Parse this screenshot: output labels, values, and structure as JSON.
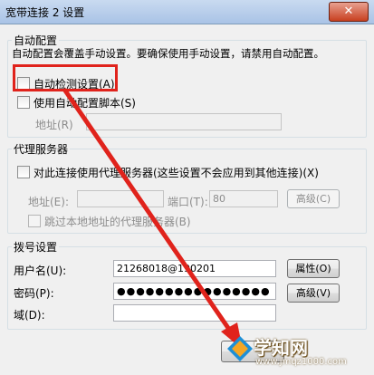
{
  "window": {
    "title": "宽带连接 2 设置",
    "close_label": "✕"
  },
  "auto_config": {
    "group_title": "自动配置",
    "description": "自动配置会覆盖手动设置。要确保使用手动设置，请禁用自动配置。",
    "auto_detect_label": "自动检测设置(A)",
    "auto_detect_checked": false,
    "use_script_label": "使用自动配置脚本(S)",
    "use_script_checked": false,
    "address_label": "地址(R)",
    "address_value": ""
  },
  "proxy": {
    "group_title": "代理服务器",
    "use_proxy_label": "对此连接使用代理服务器(这些设置不会应用到其他连接)(X)",
    "use_proxy_checked": false,
    "address_label": "地址(E):",
    "address_value": "",
    "port_label": "端口(T):",
    "port_value": "80",
    "advanced_label": "高级(C)",
    "bypass_label": "跳过本地地址的代理服务器(B)",
    "bypass_checked": false
  },
  "dialup": {
    "group_title": "拨号设置",
    "username_label": "用户名(U):",
    "username_value": "21268018@190201",
    "password_label": "密码(P):",
    "password_value": "●●●●●●●●●●●●●●●●",
    "domain_label": "域(D):",
    "domain_value": "",
    "properties_label": "属性(O)",
    "advanced_label": "高级(V)"
  },
  "watermark": {
    "text": "学知网",
    "url": "www.jmqz1000.com"
  },
  "colors": {
    "highlight": "#e0231c",
    "arrow": "#e0231c",
    "titlebar": "#b5cbe8"
  }
}
